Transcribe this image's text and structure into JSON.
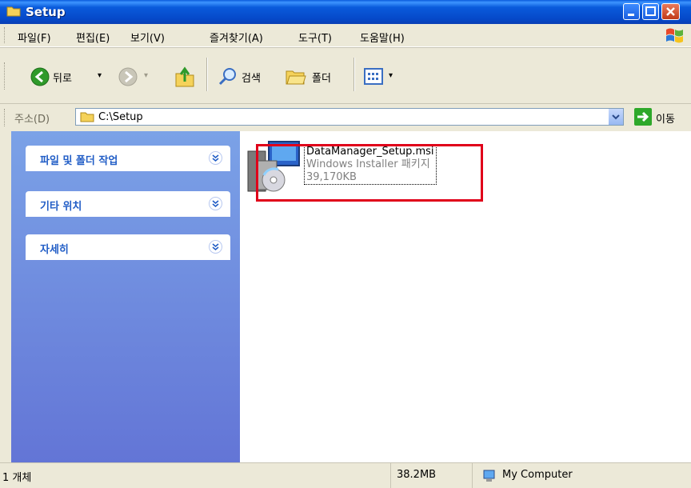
{
  "window": {
    "title": "Setup"
  },
  "menu": [
    "파일(F)",
    "편집(E)",
    "보기(V)",
    "즐겨찾기(A)",
    "도구(T)",
    "도움말(H)"
  ],
  "toolbar": {
    "back_label": "뒤로",
    "search_label": "검색",
    "folders_label": "폴더"
  },
  "address": {
    "label": "주소(D)",
    "value": "C:\\Setup",
    "go_label": "이동"
  },
  "left_panels": [
    {
      "title": "파일 및 폴더 작업"
    },
    {
      "title": "기타 위치"
    },
    {
      "title": "자세히"
    }
  ],
  "file": {
    "name": "DataManager_Setup.msi",
    "type": "Windows Installer 패키지",
    "size": "39,170KB"
  },
  "status": {
    "objects": "1 개체",
    "size": "38.2MB",
    "location": "My Computer"
  },
  "colors": {
    "highlight": "#e0001a",
    "panel_title": "#215dc6"
  }
}
